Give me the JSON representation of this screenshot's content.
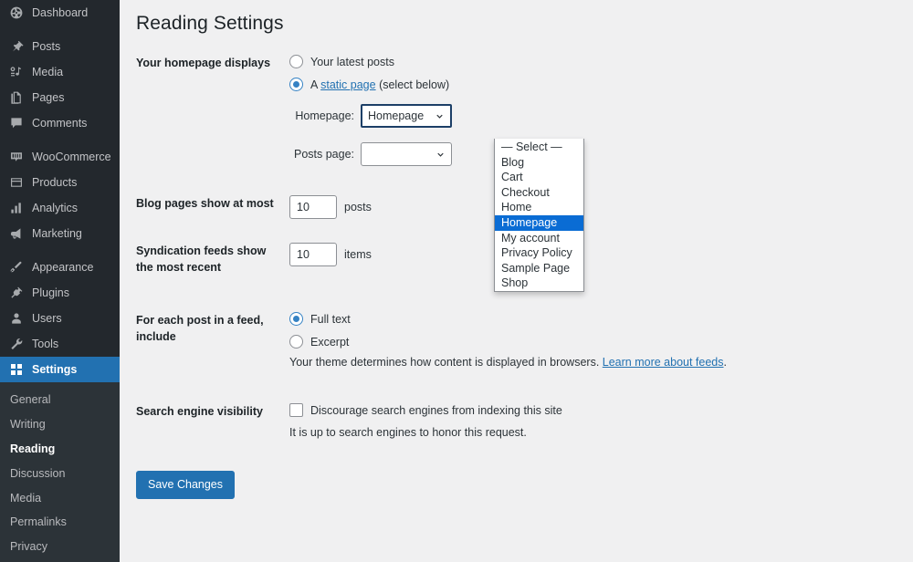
{
  "sidebar": {
    "items": [
      {
        "label": "Dashboard",
        "icon": "dashboard-icon",
        "gap": false
      },
      {
        "label": "Posts",
        "icon": "pin-icon",
        "gap": true
      },
      {
        "label": "Media",
        "icon": "media-icon",
        "gap": false
      },
      {
        "label": "Pages",
        "icon": "pages-icon",
        "gap": false
      },
      {
        "label": "Comments",
        "icon": "comment-icon",
        "gap": false
      },
      {
        "label": "WooCommerce",
        "icon": "woocommerce-icon",
        "gap": true
      },
      {
        "label": "Products",
        "icon": "products-icon",
        "gap": false
      },
      {
        "label": "Analytics",
        "icon": "analytics-icon",
        "gap": false
      },
      {
        "label": "Marketing",
        "icon": "megaphone-icon",
        "gap": false
      },
      {
        "label": "Appearance",
        "icon": "brush-icon",
        "gap": true
      },
      {
        "label": "Plugins",
        "icon": "plugins-icon",
        "gap": false
      },
      {
        "label": "Users",
        "icon": "users-icon",
        "gap": false
      },
      {
        "label": "Tools",
        "icon": "tools-icon",
        "gap": false
      },
      {
        "label": "Settings",
        "icon": "settings-icon",
        "gap": false,
        "current": true
      }
    ],
    "submenu": [
      {
        "label": "General"
      },
      {
        "label": "Writing"
      },
      {
        "label": "Reading",
        "current": true
      },
      {
        "label": "Discussion"
      },
      {
        "label": "Media"
      },
      {
        "label": "Permalinks"
      },
      {
        "label": "Privacy"
      }
    ],
    "colors": {
      "background": "#23282d",
      "submenu_background": "#2c3338",
      "current_background": "#2271b1",
      "text": "#c3c4c7"
    }
  },
  "page": {
    "title": "Reading Settings"
  },
  "homepage_displays": {
    "label": "Your homepage displays",
    "options": [
      {
        "label": "Your latest posts",
        "checked": false
      },
      {
        "label": "A ",
        "link": "static page",
        "suffix": " (select below)",
        "checked": true
      }
    ]
  },
  "homepage_select": {
    "label": "Homepage:",
    "value": "Homepage",
    "open": true,
    "options": [
      {
        "label": "— Select —",
        "selected": false
      },
      {
        "label": "Blog",
        "selected": false
      },
      {
        "label": "Cart",
        "selected": false
      },
      {
        "label": "Checkout",
        "selected": false
      },
      {
        "label": "Home",
        "selected": false
      },
      {
        "label": "Homepage",
        "selected": true
      },
      {
        "label": "My account",
        "selected": false
      },
      {
        "label": "Privacy Policy",
        "selected": false
      },
      {
        "label": "Sample Page",
        "selected": false
      },
      {
        "label": "Shop",
        "selected": false
      }
    ],
    "highlight_color": "#0a6cd4"
  },
  "posts_select": {
    "label": "Posts page:",
    "value": ""
  },
  "blog_pages": {
    "label": "Blog pages show at most",
    "value": "10",
    "unit": "posts"
  },
  "syndication_feeds": {
    "label": "Syndication feeds show the most recent",
    "value": "10",
    "unit": "items"
  },
  "feed_include": {
    "label": "For each post in a feed, include",
    "options": [
      {
        "label": "Full text",
        "checked": true
      },
      {
        "label": "Excerpt",
        "checked": false
      }
    ],
    "helper_prefix": "Your theme determines how content is displayed in browsers. ",
    "helper_link": "Learn more about feeds",
    "helper_suffix": "."
  },
  "search_visibility": {
    "label": "Search engine visibility",
    "checkbox_label": "Discourage search engines from indexing this site",
    "checked": false,
    "helper": "It is up to search engines to honor this request."
  },
  "actions": {
    "save_label": "Save Changes",
    "save_color": "#2271b1"
  }
}
